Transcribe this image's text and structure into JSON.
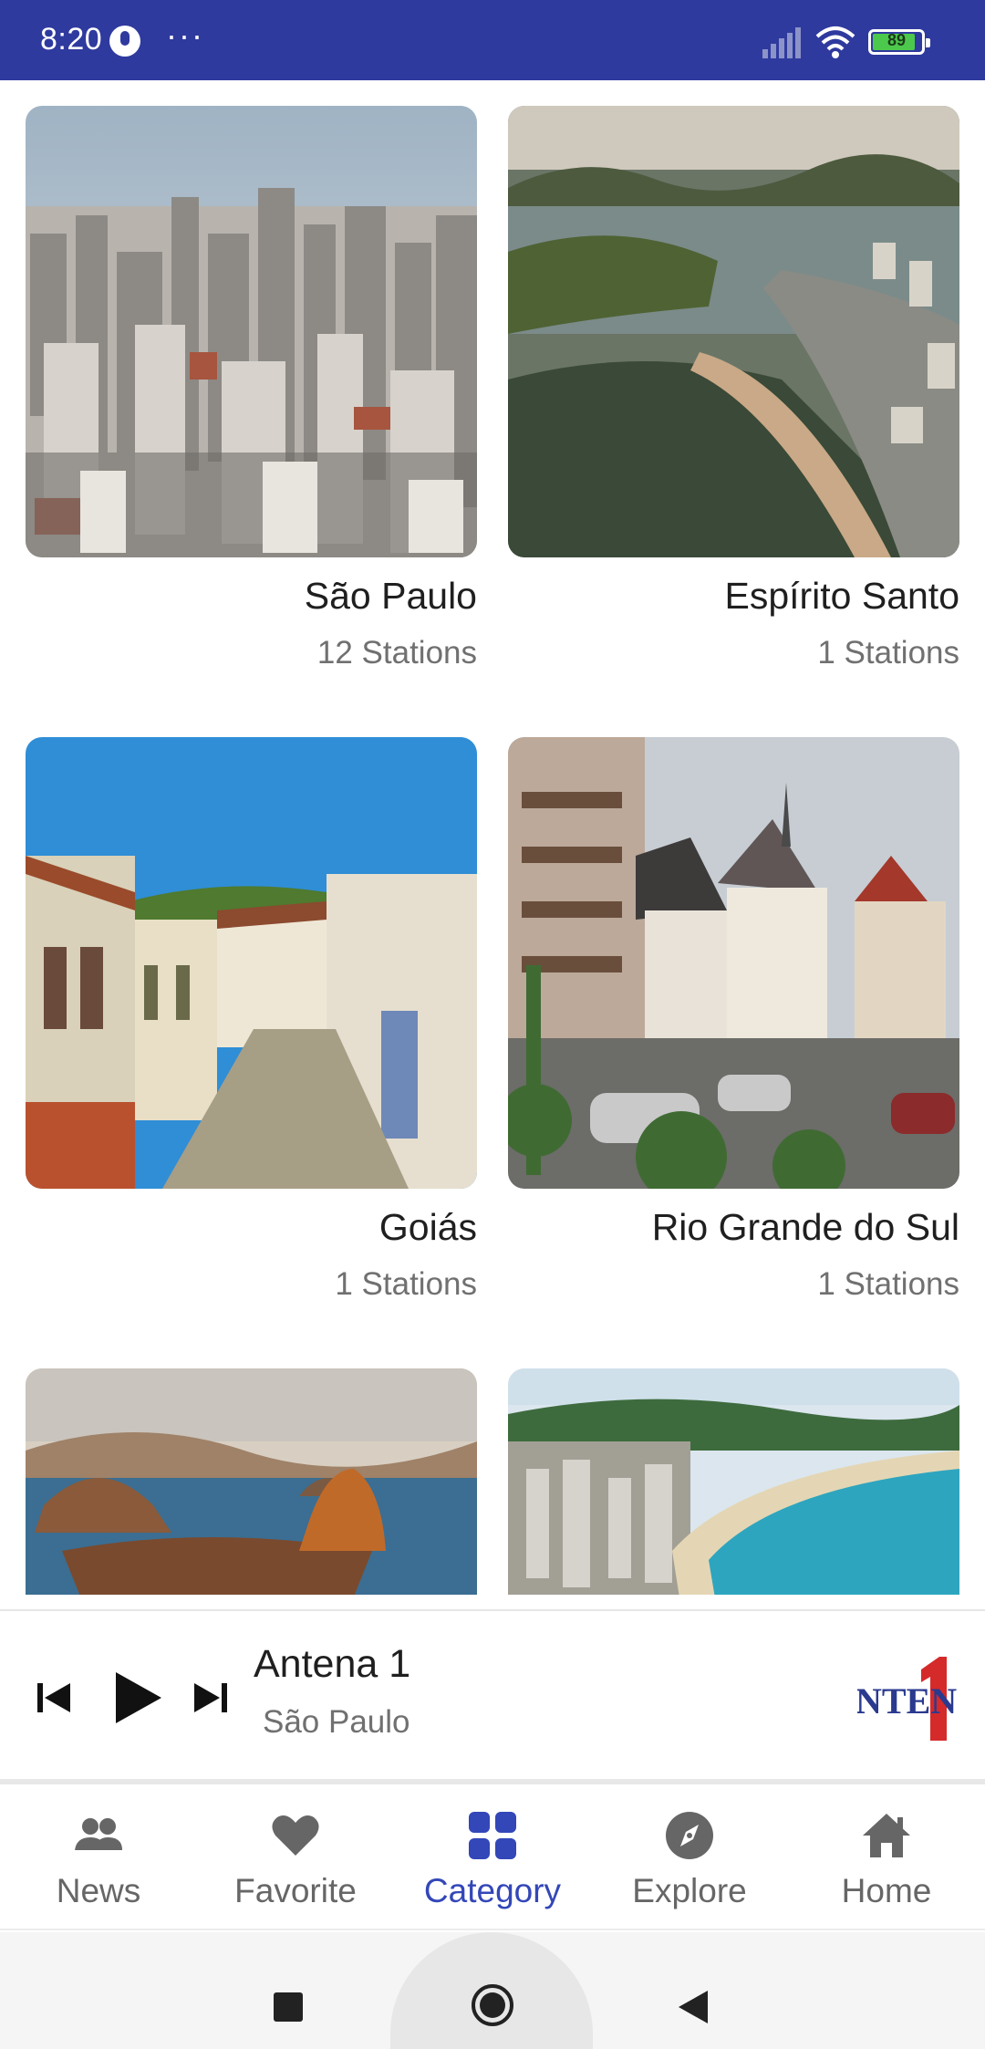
{
  "status_bar": {
    "time": "8:20",
    "dots": "···",
    "battery": "89",
    "battery_level": 0.89,
    "icons": [
      "microphone-icon",
      "signal-icon",
      "wifi-icon",
      "battery-icon"
    ]
  },
  "categories": [
    {
      "name": "São Paulo",
      "count": "12 Stations",
      "image": "sao-paulo-skyline-photo"
    },
    {
      "name": "Espírito Santo",
      "count": "1 Stations",
      "image": "espirito-santo-coast-photo"
    },
    {
      "name": "Goiás",
      "count": "1 Stations",
      "image": "goias-colonial-street-photo"
    },
    {
      "name": "Rio Grande do Sul",
      "count": "1 Stations",
      "image": "rio-grande-do-sul-town-photo"
    },
    {
      "name": "",
      "count": "",
      "image": "rio-de-janeiro-sugarloaf-photo"
    },
    {
      "name": "",
      "count": "",
      "image": "santa-catarina-beach-photo"
    }
  ],
  "player": {
    "title": "Antena 1",
    "subtitle": "São Paulo",
    "logo": "antena-1-logo",
    "controls": [
      "skip-previous-icon",
      "play-icon",
      "skip-next-icon"
    ]
  },
  "bottom_nav": {
    "items": [
      {
        "label": "News",
        "icon": "people-icon",
        "active": false
      },
      {
        "label": "Favorite",
        "icon": "heart-icon",
        "active": false
      },
      {
        "label": "Category",
        "icon": "grid-icon",
        "active": true
      },
      {
        "label": "Explore",
        "icon": "compass-icon",
        "active": false
      },
      {
        "label": "Home",
        "icon": "home-icon",
        "active": false
      }
    ]
  },
  "system_nav": {
    "buttons": [
      "recents-button",
      "home-button",
      "back-button"
    ]
  },
  "colors": {
    "status_bar": "#2f3a9e",
    "active_tab": "#3347b8",
    "inactive_tab": "#666666",
    "primary_text": "#1f1f1f",
    "secondary_text": "#707070"
  }
}
